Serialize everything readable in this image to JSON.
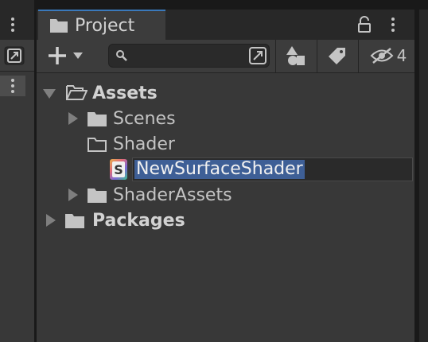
{
  "window": {
    "tab_title": "Project"
  },
  "toolbar": {
    "search_value": "",
    "hidden_count": "4"
  },
  "tree": {
    "items": [
      {
        "label": "Assets"
      },
      {
        "label": "Scenes"
      },
      {
        "label": "Shader"
      },
      {
        "label": "NewSurfaceShader"
      },
      {
        "label": "ShaderAssets"
      },
      {
        "label": "Packages"
      }
    ]
  },
  "icons": {
    "shader_letter": "S"
  },
  "colors": {
    "tab_accent": "#3a79bb",
    "selection": "#3e5f96",
    "panel_bg": "#383838"
  }
}
